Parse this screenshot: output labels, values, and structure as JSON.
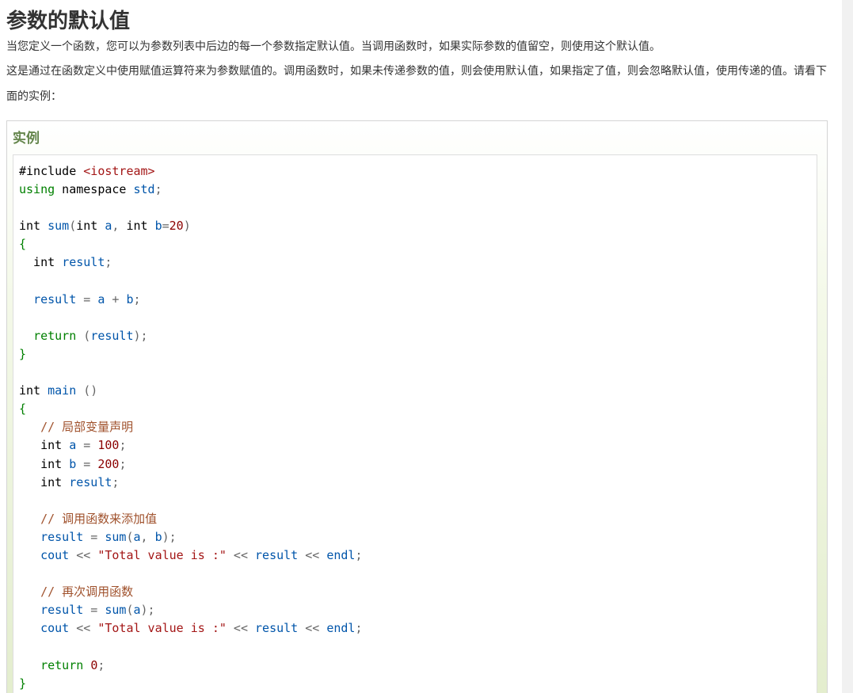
{
  "page": {
    "title": "参数的默认值",
    "paragraph_1": "当您定义一个函数，您可以为参数列表中后边的每一个参数指定默认值。当调用函数时，如果实际参数的值留空，则使用这个默认值。",
    "paragraph_2": "这是通过在函数定义中使用赋值运算符来为参数赋值的。调用函数时，如果未传递参数的值，则会使用默认值，如果指定了值，则会忽略默认值，使用传递的值。请看下面的实例："
  },
  "example": {
    "title": "实例",
    "code_lines": [
      [
        [
          "d",
          "#include "
        ],
        [
          "s",
          "<iostream>"
        ]
      ],
      [
        [
          "k",
          "using"
        ],
        [
          "d",
          " namespace "
        ],
        [
          "v",
          "std"
        ],
        [
          "p",
          ";"
        ]
      ],
      [],
      [
        [
          "d",
          "int "
        ],
        [
          "v",
          "sum"
        ],
        [
          "p",
          "("
        ],
        [
          "d",
          "int "
        ],
        [
          "v",
          "a"
        ],
        [
          "p",
          ", "
        ],
        [
          "d",
          "int "
        ],
        [
          "v",
          "b"
        ],
        [
          "p",
          "="
        ],
        [
          "n",
          "20"
        ],
        [
          "p",
          ")"
        ]
      ],
      [
        [
          "k",
          "{"
        ]
      ],
      [
        [
          "d",
          "  int "
        ],
        [
          "v",
          "result"
        ],
        [
          "p",
          ";"
        ]
      ],
      [],
      [
        [
          "d",
          "  "
        ],
        [
          "v",
          "result"
        ],
        [
          "p",
          " = "
        ],
        [
          "v",
          "a"
        ],
        [
          "p",
          " + "
        ],
        [
          "v",
          "b"
        ],
        [
          "p",
          ";"
        ]
      ],
      [],
      [
        [
          "d",
          "  "
        ],
        [
          "k",
          "return"
        ],
        [
          "d",
          " "
        ],
        [
          "p",
          "("
        ],
        [
          "v",
          "result"
        ],
        [
          "p",
          ");"
        ]
      ],
      [
        [
          "k",
          "}"
        ]
      ],
      [],
      [
        [
          "d",
          "int "
        ],
        [
          "v",
          "main"
        ],
        [
          "d",
          " "
        ],
        [
          "p",
          "()"
        ]
      ],
      [
        [
          "k",
          "{"
        ]
      ],
      [
        [
          "d",
          "   "
        ],
        [
          "c",
          "// 局部变量声明"
        ]
      ],
      [
        [
          "d",
          "   int "
        ],
        [
          "v",
          "a"
        ],
        [
          "p",
          " = "
        ],
        [
          "n",
          "100"
        ],
        [
          "p",
          ";"
        ]
      ],
      [
        [
          "d",
          "   int "
        ],
        [
          "v",
          "b"
        ],
        [
          "p",
          " = "
        ],
        [
          "n",
          "200"
        ],
        [
          "p",
          ";"
        ]
      ],
      [
        [
          "d",
          "   int "
        ],
        [
          "v",
          "result"
        ],
        [
          "p",
          ";"
        ]
      ],
      [],
      [
        [
          "d",
          "   "
        ],
        [
          "c",
          "// 调用函数来添加值"
        ]
      ],
      [
        [
          "d",
          "   "
        ],
        [
          "v",
          "result"
        ],
        [
          "p",
          " = "
        ],
        [
          "v",
          "sum"
        ],
        [
          "p",
          "("
        ],
        [
          "v",
          "a"
        ],
        [
          "p",
          ", "
        ],
        [
          "v",
          "b"
        ],
        [
          "p",
          ");"
        ]
      ],
      [
        [
          "d",
          "   "
        ],
        [
          "v",
          "cout"
        ],
        [
          "p",
          " << "
        ],
        [
          "s",
          "\"Total value is :\""
        ],
        [
          "p",
          " << "
        ],
        [
          "v",
          "result"
        ],
        [
          "p",
          " << "
        ],
        [
          "v",
          "endl"
        ],
        [
          "p",
          ";"
        ]
      ],
      [],
      [
        [
          "d",
          "   "
        ],
        [
          "c",
          "// 再次调用函数"
        ]
      ],
      [
        [
          "d",
          "   "
        ],
        [
          "v",
          "result"
        ],
        [
          "p",
          " = "
        ],
        [
          "v",
          "sum"
        ],
        [
          "p",
          "("
        ],
        [
          "v",
          "a"
        ],
        [
          "p",
          ");"
        ]
      ],
      [
        [
          "d",
          "   "
        ],
        [
          "v",
          "cout"
        ],
        [
          "p",
          " << "
        ],
        [
          "s",
          "\"Total value is :\""
        ],
        [
          "p",
          " << "
        ],
        [
          "v",
          "result"
        ],
        [
          "p",
          " << "
        ],
        [
          "v",
          "endl"
        ],
        [
          "p",
          ";"
        ]
      ],
      [],
      [
        [
          "d",
          "   "
        ],
        [
          "k",
          "return"
        ],
        [
          "d",
          " "
        ],
        [
          "n",
          "0"
        ],
        [
          "p",
          ";"
        ]
      ],
      [
        [
          "k",
          "}"
        ]
      ]
    ]
  },
  "colors": {
    "example_title": "#64854c",
    "keyword": "#008000",
    "identifier": "#0055aa",
    "string": "#a31515",
    "number": "#8b0000",
    "comment": "#a0522d"
  }
}
